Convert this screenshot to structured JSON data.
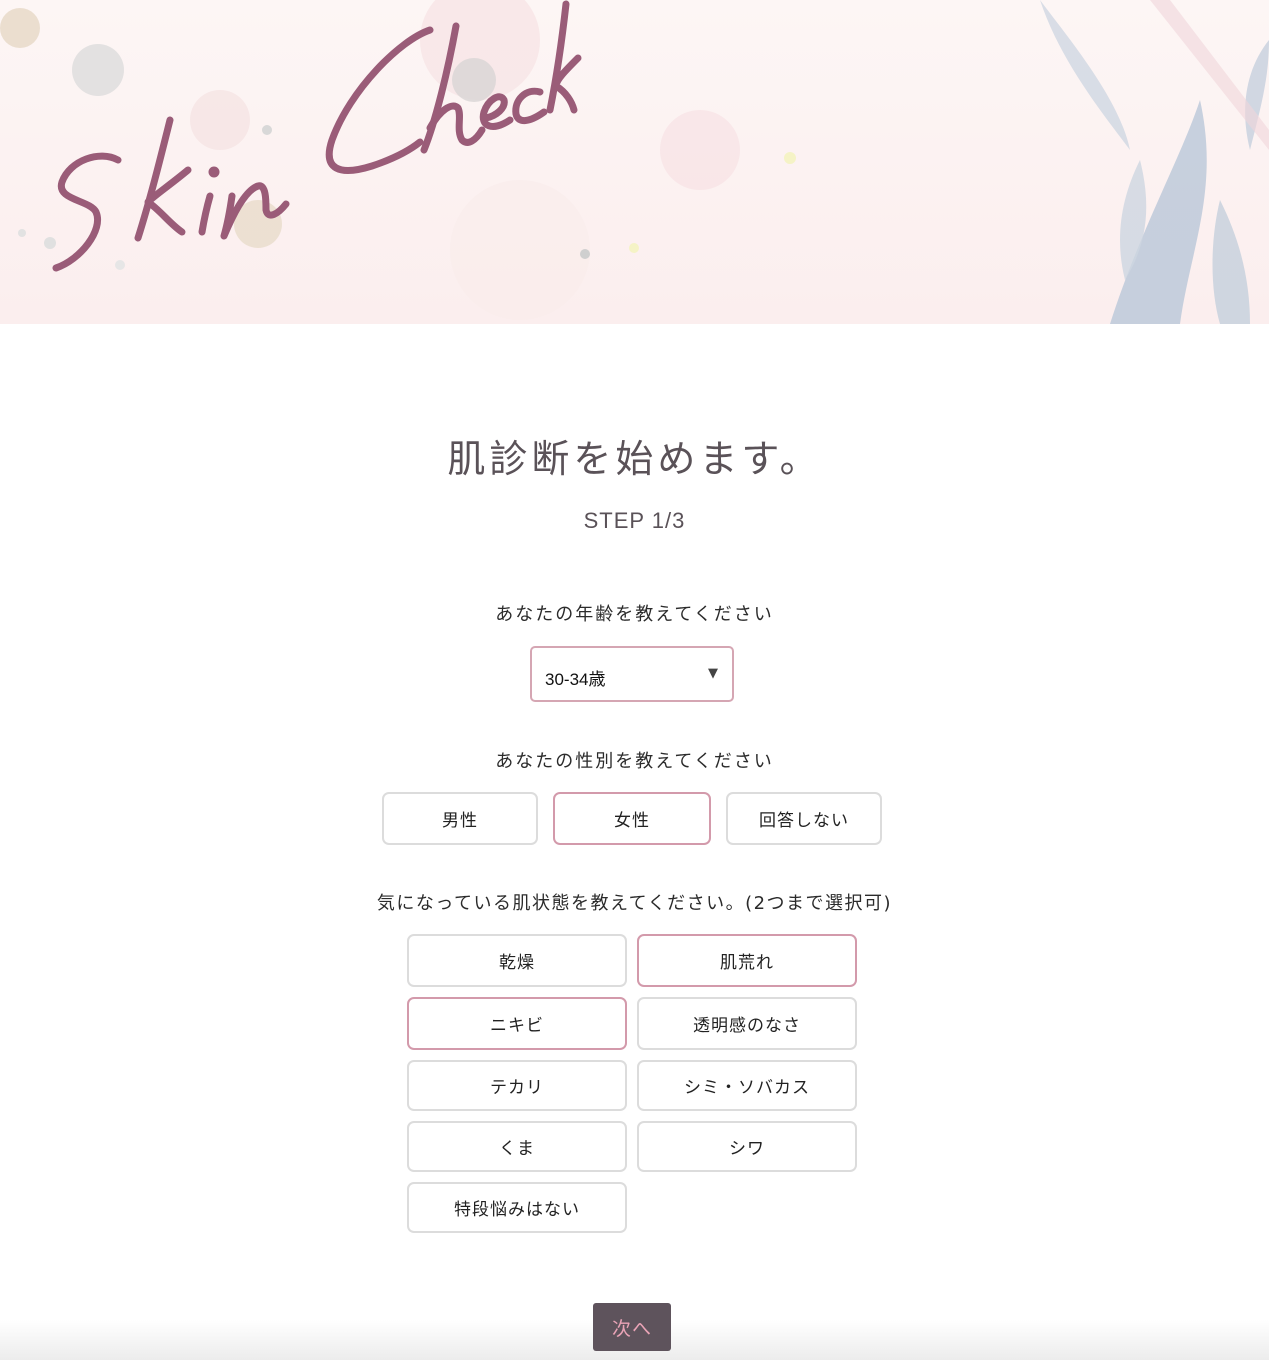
{
  "header": {
    "logo_text": "Skin Check"
  },
  "page": {
    "title": "肌診断を始めます。",
    "step": "STEP 1/3"
  },
  "age": {
    "question": "あなたの年齢を教えてください",
    "selected": "30-34歳"
  },
  "gender": {
    "question": "あなたの性別を教えてください",
    "options": [
      "男性",
      "女性",
      "回答しない"
    ],
    "selected": "女性"
  },
  "concerns": {
    "question": "気になっている肌状態を教えてください。(2つまで選択可)",
    "options": [
      "乾燥",
      "肌荒れ",
      "ニキビ",
      "透明感のなさ",
      "テカリ",
      "シミ・ソバカス",
      "くま",
      "シワ",
      "特段悩みはない"
    ],
    "selected": [
      "肌荒れ",
      "ニキビ"
    ]
  },
  "actions": {
    "next_label": "次へ"
  },
  "colors": {
    "accent": "#d39aab",
    "logo": "#9a5c78",
    "button_bg": "#5e535c",
    "button_text": "#e9a3b6"
  }
}
